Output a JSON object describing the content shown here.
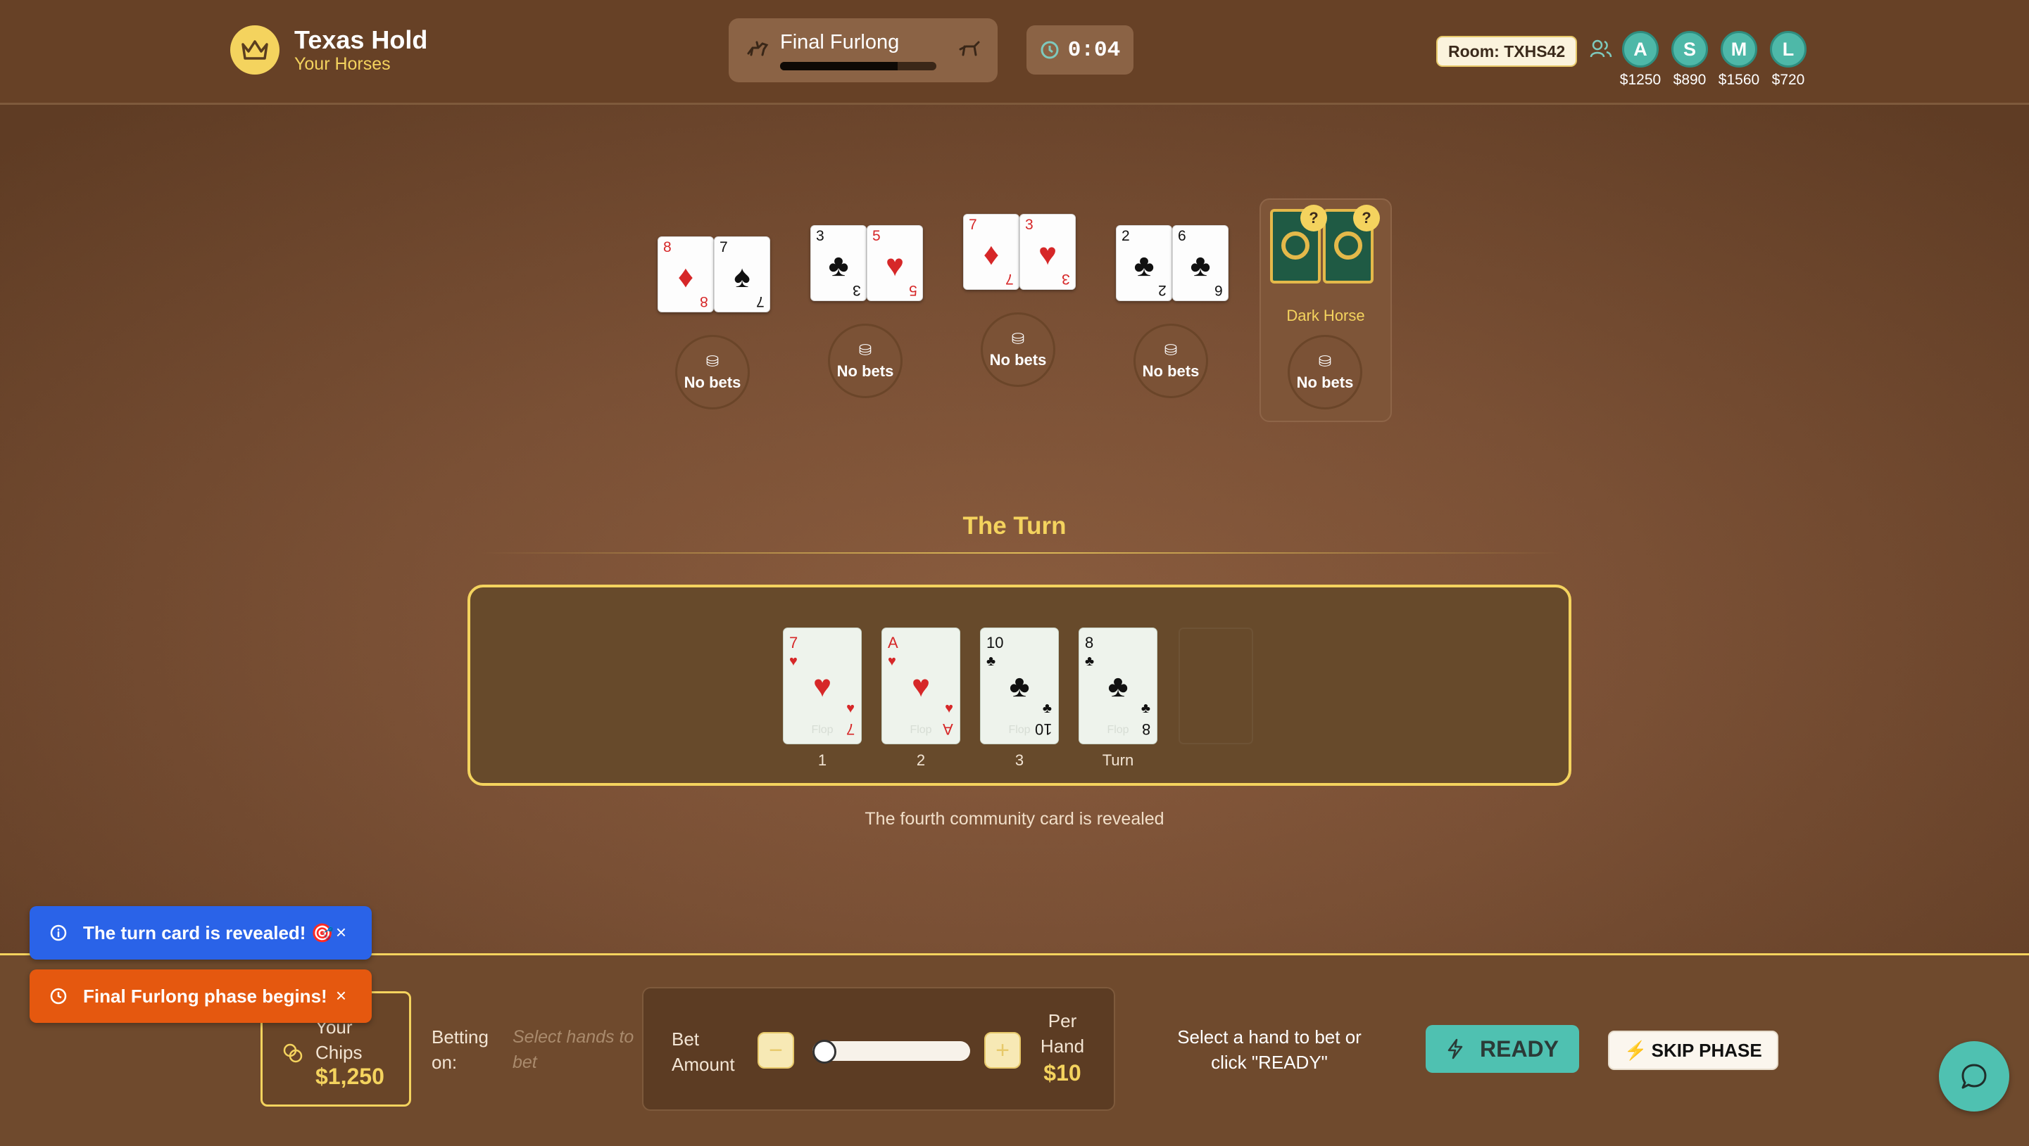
{
  "header": {
    "brand_title": "Texas Hold",
    "brand_subtitle": "Your Horses",
    "race_name": "Final Furlong",
    "race_progress": 0.75,
    "timer": "0:04",
    "room": "Room: TXHS42",
    "players": [
      {
        "initial": "A",
        "chips": "$1250"
      },
      {
        "initial": "S",
        "chips": "$890"
      },
      {
        "initial": "M",
        "chips": "$1560"
      },
      {
        "initial": "L",
        "chips": "$720"
      }
    ]
  },
  "hands": [
    {
      "cards": [
        {
          "rank": "8",
          "suit": "♦",
          "color": "red"
        },
        {
          "rank": "7",
          "suit": "♠",
          "color": "black"
        }
      ],
      "bet_label": "No bets"
    },
    {
      "cards": [
        {
          "rank": "3",
          "suit": "♣",
          "color": "black"
        },
        {
          "rank": "5",
          "suit": "♥",
          "color": "red"
        }
      ],
      "bet_label": "No bets"
    },
    {
      "cards": [
        {
          "rank": "7",
          "suit": "♦",
          "color": "red"
        },
        {
          "rank": "3",
          "suit": "♥",
          "color": "red"
        }
      ],
      "bet_label": "No bets"
    },
    {
      "cards": [
        {
          "rank": "2",
          "suit": "♣",
          "color": "black"
        },
        {
          "rank": "6",
          "suit": "♣",
          "color": "black"
        }
      ],
      "bet_label": "No bets"
    }
  ],
  "dark_horse": {
    "label": "Dark Horse",
    "badge": "?",
    "bet_label": "No bets"
  },
  "phase": {
    "title": "The Turn",
    "description": "The fourth community card is revealed",
    "community": [
      {
        "rank": "7",
        "suit": "♥",
        "color": "red",
        "label": "1"
      },
      {
        "rank": "A",
        "suit": "♥",
        "color": "red",
        "label": "2"
      },
      {
        "rank": "10",
        "suit": "♣",
        "color": "black",
        "label": "3"
      },
      {
        "rank": "8",
        "suit": "♣",
        "color": "black",
        "label": "Turn"
      }
    ],
    "card_watermark": "Flop"
  },
  "bottom": {
    "chips_label": "Your Chips",
    "chips_amount": "$1,250",
    "betting_on_label": "Betting on:",
    "betting_on_hint": "Select hands to bet",
    "bet_amount_label": "Bet Amount",
    "minus": "−",
    "plus": "+",
    "slider_value": 0,
    "per_hand_label": "Per Hand",
    "per_hand_amount": "$10",
    "select_hint": "Select a hand to bet or click \"READY\"",
    "ready_label": "READY",
    "skip_label": "SKIP PHASE",
    "skip_icon": "⚡"
  },
  "toasts": [
    {
      "message": "The turn card is revealed! 🎯",
      "close": "×",
      "color": "#2a63e8"
    },
    {
      "message": "Final Furlong phase begins!",
      "close": "×",
      "color": "#e5580f"
    }
  ]
}
